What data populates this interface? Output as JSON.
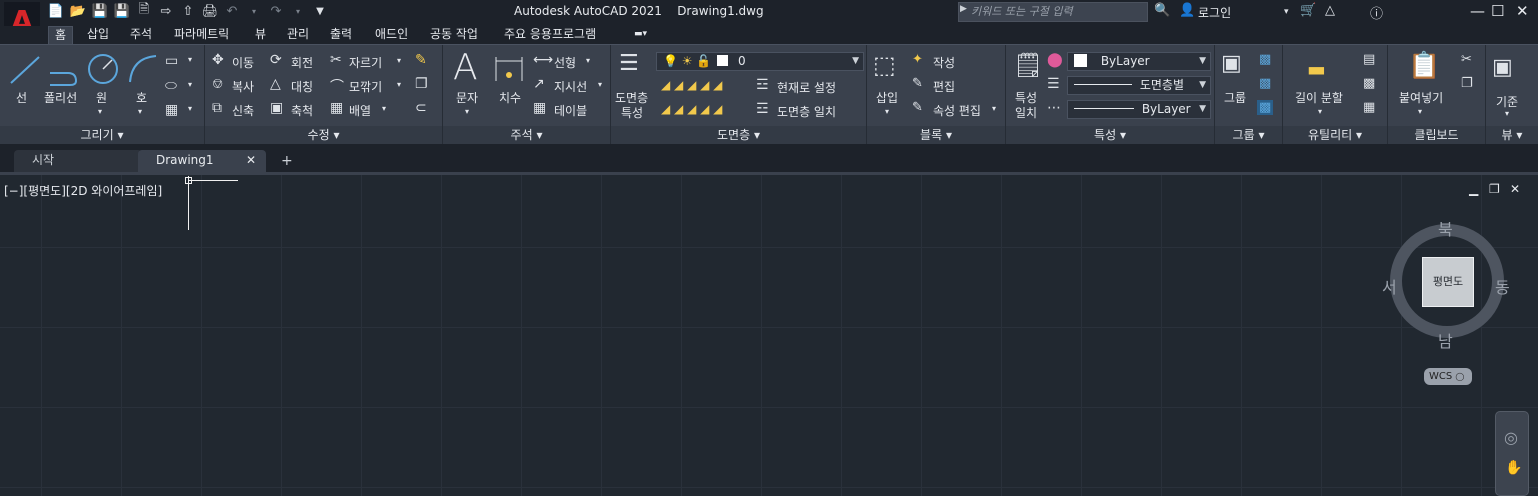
{
  "app": {
    "logo_letter": "A",
    "title": "Autodesk AutoCAD 2021",
    "document": "Drawing1.dwg",
    "search_placeholder": "키워드 또는 구절 입력",
    "login": "로그인",
    "accent_color": "#d7262a"
  },
  "qat": {
    "icons": [
      "new-icon",
      "open-icon",
      "save-icon",
      "save-as-icon",
      "publish-icon",
      "import-icon",
      "export-icon",
      "print-icon",
      "undo-icon",
      "redo-icon",
      "customize-icon"
    ]
  },
  "tabs": [
    "홈",
    "삽입",
    "주석",
    "파라메트릭",
    "뷰",
    "관리",
    "출력",
    "애드인",
    "공동 작업",
    "주요 응용프로그램"
  ],
  "ribbon": {
    "draw": {
      "title": "그리기",
      "line": "선",
      "polyline": "폴리선",
      "circle": "원",
      "arc": "호"
    },
    "modify": {
      "title": "수정",
      "move": "이동",
      "rotate": "회전",
      "trim": "자르기",
      "copy": "복사",
      "mirror": "대칭",
      "fillet": "모깎기",
      "stretch": "신축",
      "scale": "축척",
      "array": "배열"
    },
    "annotation": {
      "title": "주석",
      "text": "문자",
      "dimension": "치수",
      "linear": "선형",
      "leader": "지시선",
      "table": "테이블"
    },
    "layers": {
      "title": "도면층",
      "properties_line1": "도면층",
      "properties_line2": "특성",
      "current_layer": "0",
      "set_current": "현재로 설정",
      "match_layer": "도면층 일치"
    },
    "block": {
      "title": "블록",
      "insert": "삽입",
      "create": "작성",
      "edit": "편집",
      "edit_attributes": "속성 편집"
    },
    "properties": {
      "title": "특성",
      "match_line1": "특성",
      "match_line2": "일치",
      "color": "ByLayer",
      "linetype": "도면층별",
      "lineweight": "ByLayer"
    },
    "groups": {
      "title": "그룹",
      "group": "그룹"
    },
    "utilities": {
      "title": "유틸리티",
      "measure": "길이 분할"
    },
    "clipboard": {
      "title": "클립보드",
      "paste": "붙여넣기"
    },
    "view": {
      "title": "뷰",
      "base": "기준"
    }
  },
  "doc_tabs": {
    "start": "시작",
    "drawing": "Drawing1"
  },
  "viewport": {
    "label": "[−][평면도][2D 와이어프레임]"
  },
  "viewcube": {
    "north": "북",
    "south": "남",
    "east": "동",
    "west": "서",
    "face": "평면도",
    "wcs": "WCS"
  }
}
